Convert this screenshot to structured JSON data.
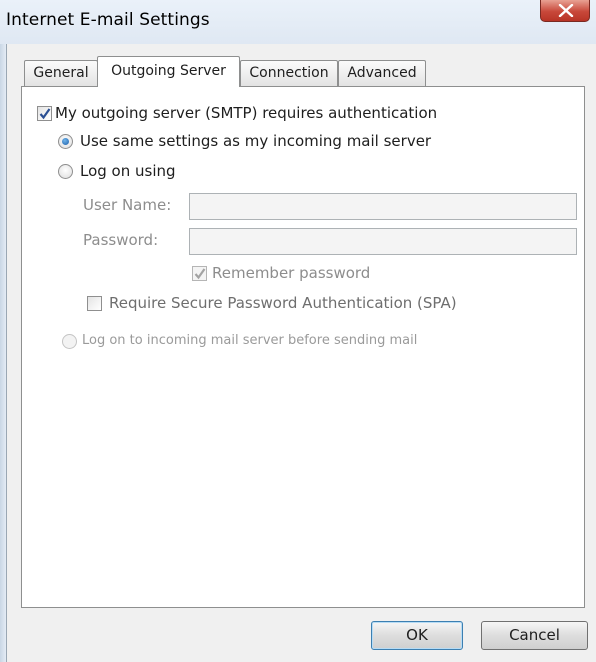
{
  "window": {
    "title": "Internet E-mail Settings",
    "close_icon": "close-icon"
  },
  "tabs": [
    {
      "label": "General",
      "active": false
    },
    {
      "label": "Outgoing Server",
      "active": true
    },
    {
      "label": "Connection",
      "active": false
    },
    {
      "label": "Advanced",
      "active": false
    }
  ],
  "outgoing": {
    "requires_auth_label": "My outgoing server (SMTP) requires authentication",
    "requires_auth_checked": true,
    "use_same_settings_label": "Use same settings as my incoming mail server",
    "use_same_settings_selected": true,
    "log_on_using_label": "Log on using",
    "log_on_using_selected": false,
    "user_name_label": "User Name:",
    "user_name_value": "",
    "password_label": "Password:",
    "password_value": "",
    "remember_password_label": "Remember password",
    "remember_password_checked": true,
    "spa_label": "Require Secure Password Authentication (SPA)",
    "spa_checked": false,
    "log_on_incoming_label": "Log on to incoming mail server before sending mail",
    "log_on_incoming_selected": false
  },
  "buttons": {
    "ok_label": "OK",
    "cancel_label": "Cancel"
  }
}
